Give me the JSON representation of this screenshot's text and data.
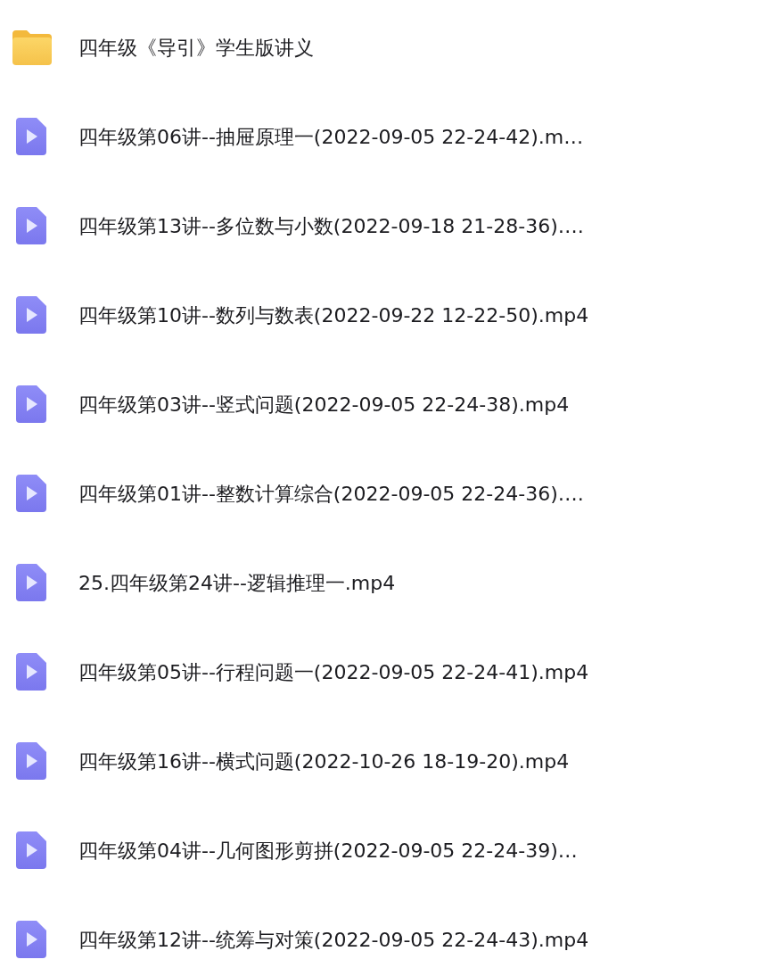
{
  "files": [
    {
      "kind": "folder",
      "name": "四年级《导引》学生版讲义"
    },
    {
      "kind": "video",
      "name": "四年级第06讲--抽屉原理一(2022-09-05 22-24-42).m…"
    },
    {
      "kind": "video",
      "name": "四年级第13讲--多位数与小数(2022-09-18 21-28-36)…."
    },
    {
      "kind": "video",
      "name": "四年级第10讲--数列与数表(2022-09-22 12-22-50).mp4"
    },
    {
      "kind": "video",
      "name": "四年级第03讲--竖式问题(2022-09-05 22-24-38).mp4"
    },
    {
      "kind": "video",
      "name": "四年级第01讲--整数计算综合(2022-09-05 22-24-36)…."
    },
    {
      "kind": "video",
      "name": "25.四年级第24讲--逻辑推理一.mp4"
    },
    {
      "kind": "video",
      "name": "四年级第05讲--行程问题一(2022-09-05 22-24-41).mp4"
    },
    {
      "kind": "video",
      "name": "四年级第16讲--横式问题(2022-10-26 18-19-20).mp4"
    },
    {
      "kind": "video",
      "name": "四年级第04讲--几何图形剪拼(2022-09-05 22-24-39)…"
    },
    {
      "kind": "video",
      "name": "四年级第12讲--统筹与对策(2022-09-05 22-24-43).mp4"
    }
  ]
}
